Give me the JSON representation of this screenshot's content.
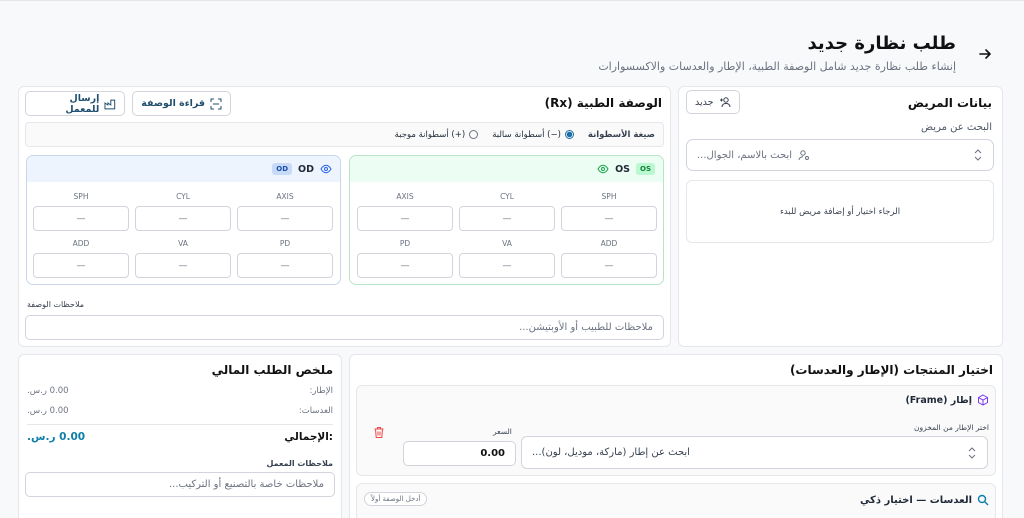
{
  "header": {
    "title": "طلب نظارة جديد",
    "subtitle": "إنشاء طلب نظارة جديد شامل الوصفة الطبية، الإطار والعدسات والاكسسوارات",
    "back_icon": "arrow-right-icon"
  },
  "patient": {
    "title": "بيانات المريض",
    "new_label": "جديد",
    "search_label": "البحث عن مريض",
    "search_placeholder": "ابحث بالاسم، الجوال...",
    "empty_text": "الرجاء اختيار أو إضافة مريض للبدء"
  },
  "rx": {
    "title": "الوصفة الطبية (Rx)",
    "read_button": "قراءة الوصفة",
    "send_button": "إرسال للمعمل",
    "formula_label": "صيغة الأسطوانة",
    "minus_option": "(−) أسطوانة سالبة",
    "plus_option": "(+) أسطوانة موجبة",
    "os": {
      "name": "OS",
      "tag": "OS",
      "labels": [
        "SPH",
        "CYL",
        "AXIS",
        "ADD",
        "VA",
        "PD"
      ],
      "values": [
        "—",
        "—",
        "—",
        "—",
        "—",
        "—"
      ]
    },
    "od": {
      "name": "OD",
      "tag": "OD",
      "labels": [
        "SPH",
        "CYL",
        "AXIS",
        "ADD",
        "VA",
        "PD"
      ],
      "values": [
        "—",
        "—",
        "—",
        "—",
        "—",
        "—"
      ]
    },
    "notes_label": "ملاحظات الوصفة",
    "notes_placeholder": "ملاحظات للطبيب أو الأوبتيشن..."
  },
  "products": {
    "title": "اختيار المنتجات (الإطار والعدسات)",
    "frame_title": "إطار (Frame)",
    "frame_search_label": "اختر الإطار من المخزون",
    "frame_search_placeholder": "ابحث عن إطار (ماركة، موديل، لون)...",
    "price_label": "السعر",
    "price_value": "0.00",
    "lens_title": "العدسات — اختيار ذكي",
    "lens_badge": "أدخل الوصفة أولاً"
  },
  "summary": {
    "title": "ملخص الطلب المالي",
    "rows": [
      {
        "label": "الإطار:",
        "value": "0.00 ر.س."
      },
      {
        "label": "العدسات:",
        "value": "0.00 ر.س."
      }
    ],
    "total_label": ":الإجمالي",
    "total_value": "0.00 ر.س.",
    "lab_notes_label": "ملاحظات المعمل",
    "lab_notes_placeholder": "ملاحظات خاصة بالتصنيع أو التركيب..."
  },
  "colors": {
    "accent": "#1d6fa3",
    "os_bg": "#ecfdf3",
    "od_bg": "#eef4fd",
    "total": "#0e7fa8"
  }
}
